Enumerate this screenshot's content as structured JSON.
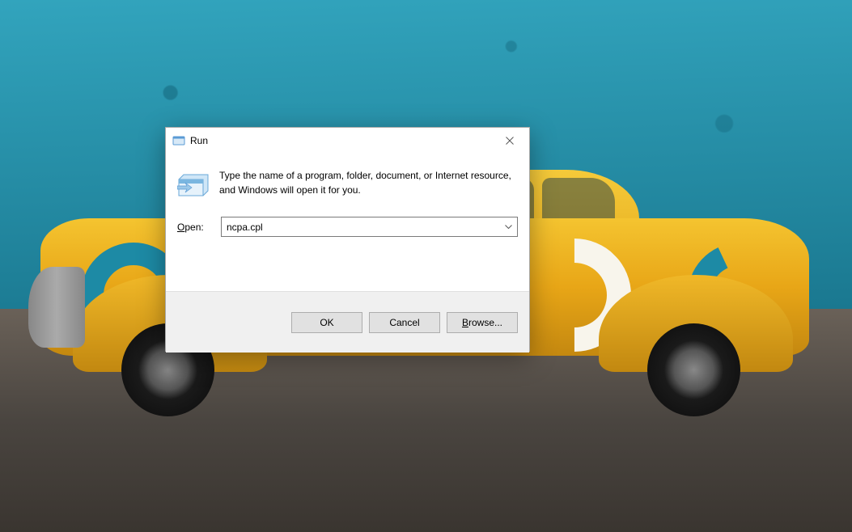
{
  "dialog": {
    "title": "Run",
    "description": "Type the name of a program, folder, document, or Internet resource, and Windows will open it for you.",
    "open_label_underlined": "O",
    "open_label_rest": "pen:",
    "input_value": "ncpa.cpl",
    "buttons": {
      "ok": "OK",
      "cancel": "Cancel",
      "browse_underlined": "B",
      "browse_rest": "rowse..."
    }
  }
}
